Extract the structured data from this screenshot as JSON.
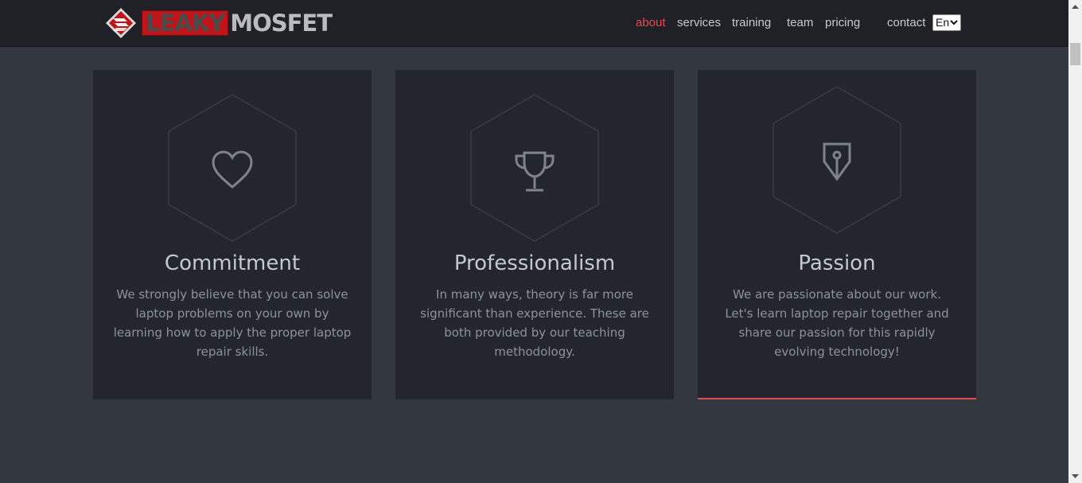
{
  "header": {
    "logo": {
      "word1": "LEAKY",
      "word2": "MOSFET"
    },
    "nav": [
      {
        "label": "about",
        "active": true
      },
      {
        "label": "services",
        "active": false
      },
      {
        "label": "training",
        "active": false
      },
      {
        "label": "team",
        "active": false
      },
      {
        "label": "pricing",
        "active": false
      },
      {
        "label": "contact",
        "active": false
      }
    ],
    "language": {
      "selected": "En"
    }
  },
  "cards": [
    {
      "icon": "heart-icon",
      "title": "Commitment",
      "text": "We strongly believe that you can solve laptop problems on your own by learning how to apply the proper laptop repair skills."
    },
    {
      "icon": "trophy-icon",
      "title": "Professionalism",
      "text": "In many ways, theory is far more significant than experience. These are both provided by our teaching methodology."
    },
    {
      "icon": "pen-nib-icon",
      "title": "Passion",
      "text": "We are passionate about our work. Let's learn laptop repair together and share our passion for this rapidly evolving technology!"
    }
  ],
  "colors": {
    "accent": "#e5484d",
    "header_bg": "#1f2126",
    "page_bg": "#333740",
    "card_bg": "#23262e",
    "logo_red": "#c0141b"
  }
}
